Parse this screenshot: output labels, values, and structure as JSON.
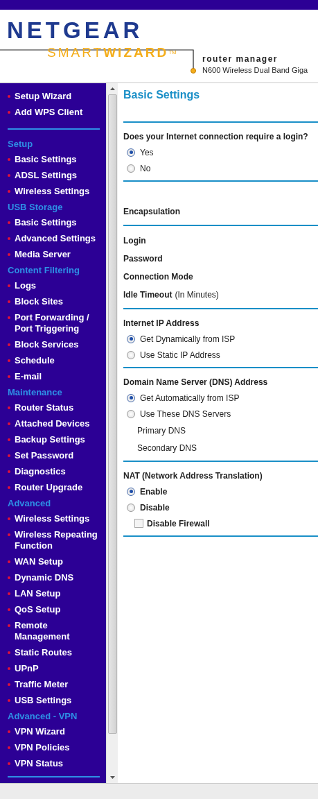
{
  "header": {
    "brand": "NETGEAR",
    "product_light": "SMART",
    "product_bold": "WIZARD",
    "trademark": "TM",
    "subtitle": "router manager",
    "model": "N600 Wireless Dual Band Giga"
  },
  "sidebar": {
    "top_links": [
      "Setup Wizard",
      "Add WPS Client"
    ],
    "sections": [
      {
        "title": "Setup",
        "items": [
          "Basic Settings",
          "ADSL Settings",
          "Wireless Settings"
        ]
      },
      {
        "title": "USB Storage",
        "items": [
          "Basic Settings",
          "Advanced Settings",
          "Media Server"
        ]
      },
      {
        "title": "Content Filtering",
        "items": [
          "Logs",
          "Block Sites",
          "Port Forwarding / Port Triggering",
          "Block Services",
          "Schedule",
          "E-mail"
        ]
      },
      {
        "title": "Maintenance",
        "items": [
          "Router Status",
          "Attached Devices",
          "Backup Settings",
          "Set Password",
          "Diagnostics",
          "Router Upgrade"
        ]
      },
      {
        "title": "Advanced",
        "items": [
          "Wireless Settings",
          "Wireless Repeating Function",
          "WAN Setup",
          "Dynamic DNS",
          "LAN Setup",
          "QoS Setup",
          "Remote Management",
          "Static Routes",
          "UPnP",
          "Traffic Meter",
          "USB Settings"
        ]
      },
      {
        "title": "Advanced - VPN",
        "items": [
          "VPN Wizard",
          "VPN Policies",
          "VPN Status"
        ]
      }
    ]
  },
  "content": {
    "title": "Basic Settings",
    "sections": [
      {
        "rows": [
          {
            "kind": "question",
            "label": "Does your Internet connection require a login?"
          },
          {
            "kind": "radio",
            "label": "Yes",
            "bold": false,
            "selected": true
          },
          {
            "kind": "radio",
            "label": "No",
            "bold": false,
            "selected": false
          }
        ]
      },
      {
        "rows": [
          {
            "kind": "field",
            "label": "Encapsulation"
          }
        ]
      },
      {
        "rows": [
          {
            "kind": "field",
            "label": "Login"
          },
          {
            "kind": "field",
            "label": "Password"
          },
          {
            "kind": "field",
            "label": "Connection Mode"
          },
          {
            "kind": "field",
            "label": "Idle Timeout",
            "note": "(In Minutes)"
          }
        ]
      },
      {
        "rows": [
          {
            "kind": "question",
            "label": "Internet IP Address"
          },
          {
            "kind": "radio",
            "label": "Get Dynamically from ISP",
            "bold": false,
            "selected": true
          },
          {
            "kind": "radio",
            "label": "Use Static IP Address",
            "bold": false,
            "selected": false
          }
        ]
      },
      {
        "rows": [
          {
            "kind": "question",
            "label": "Domain Name Server (DNS) Address"
          },
          {
            "kind": "radio",
            "label": "Get Automatically from ISP",
            "bold": false,
            "selected": true
          },
          {
            "kind": "radio",
            "label": "Use These DNS Servers",
            "bold": false,
            "selected": false
          },
          {
            "kind": "sub_field",
            "label": "Primary DNS"
          },
          {
            "kind": "sub_field",
            "label": "Secondary DNS"
          }
        ]
      },
      {
        "rows": [
          {
            "kind": "question",
            "label": "NAT (Network Address Translation)"
          },
          {
            "kind": "radio",
            "label": "Enable",
            "bold": true,
            "selected": true
          },
          {
            "kind": "radio",
            "label": "Disable",
            "bold": true,
            "selected": false
          },
          {
            "kind": "checkbox",
            "label": "Disable Firewall",
            "checked": false
          }
        ]
      }
    ]
  }
}
